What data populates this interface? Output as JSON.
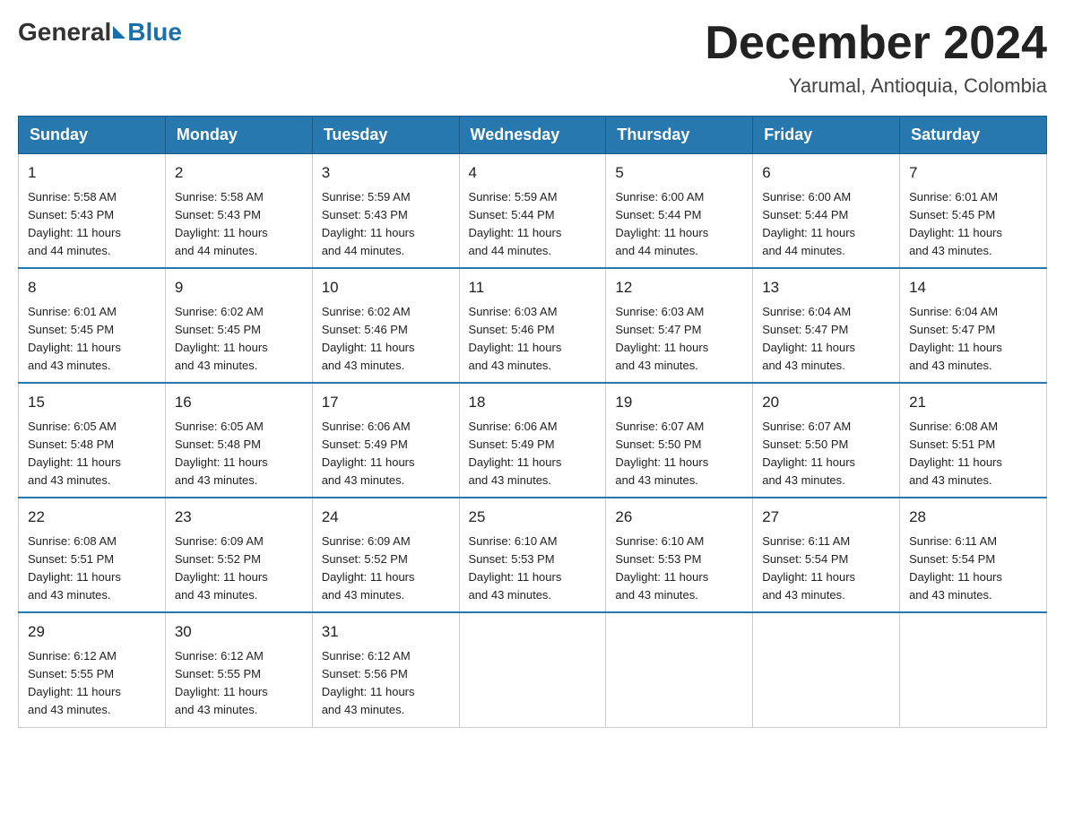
{
  "logo": {
    "general": "General",
    "blue": "Blue"
  },
  "header": {
    "title": "December 2024",
    "subtitle": "Yarumal, Antioquia, Colombia"
  },
  "days_of_week": [
    "Sunday",
    "Monday",
    "Tuesday",
    "Wednesday",
    "Thursday",
    "Friday",
    "Saturday"
  ],
  "weeks": [
    [
      {
        "day": "1",
        "sunrise": "5:58 AM",
        "sunset": "5:43 PM",
        "daylight": "11 hours and 44 minutes."
      },
      {
        "day": "2",
        "sunrise": "5:58 AM",
        "sunset": "5:43 PM",
        "daylight": "11 hours and 44 minutes."
      },
      {
        "day": "3",
        "sunrise": "5:59 AM",
        "sunset": "5:43 PM",
        "daylight": "11 hours and 44 minutes."
      },
      {
        "day": "4",
        "sunrise": "5:59 AM",
        "sunset": "5:44 PM",
        "daylight": "11 hours and 44 minutes."
      },
      {
        "day": "5",
        "sunrise": "6:00 AM",
        "sunset": "5:44 PM",
        "daylight": "11 hours and 44 minutes."
      },
      {
        "day": "6",
        "sunrise": "6:00 AM",
        "sunset": "5:44 PM",
        "daylight": "11 hours and 44 minutes."
      },
      {
        "day": "7",
        "sunrise": "6:01 AM",
        "sunset": "5:45 PM",
        "daylight": "11 hours and 43 minutes."
      }
    ],
    [
      {
        "day": "8",
        "sunrise": "6:01 AM",
        "sunset": "5:45 PM",
        "daylight": "11 hours and 43 minutes."
      },
      {
        "day": "9",
        "sunrise": "6:02 AM",
        "sunset": "5:45 PM",
        "daylight": "11 hours and 43 minutes."
      },
      {
        "day": "10",
        "sunrise": "6:02 AM",
        "sunset": "5:46 PM",
        "daylight": "11 hours and 43 minutes."
      },
      {
        "day": "11",
        "sunrise": "6:03 AM",
        "sunset": "5:46 PM",
        "daylight": "11 hours and 43 minutes."
      },
      {
        "day": "12",
        "sunrise": "6:03 AM",
        "sunset": "5:47 PM",
        "daylight": "11 hours and 43 minutes."
      },
      {
        "day": "13",
        "sunrise": "6:04 AM",
        "sunset": "5:47 PM",
        "daylight": "11 hours and 43 minutes."
      },
      {
        "day": "14",
        "sunrise": "6:04 AM",
        "sunset": "5:47 PM",
        "daylight": "11 hours and 43 minutes."
      }
    ],
    [
      {
        "day": "15",
        "sunrise": "6:05 AM",
        "sunset": "5:48 PM",
        "daylight": "11 hours and 43 minutes."
      },
      {
        "day": "16",
        "sunrise": "6:05 AM",
        "sunset": "5:48 PM",
        "daylight": "11 hours and 43 minutes."
      },
      {
        "day": "17",
        "sunrise": "6:06 AM",
        "sunset": "5:49 PM",
        "daylight": "11 hours and 43 minutes."
      },
      {
        "day": "18",
        "sunrise": "6:06 AM",
        "sunset": "5:49 PM",
        "daylight": "11 hours and 43 minutes."
      },
      {
        "day": "19",
        "sunrise": "6:07 AM",
        "sunset": "5:50 PM",
        "daylight": "11 hours and 43 minutes."
      },
      {
        "day": "20",
        "sunrise": "6:07 AM",
        "sunset": "5:50 PM",
        "daylight": "11 hours and 43 minutes."
      },
      {
        "day": "21",
        "sunrise": "6:08 AM",
        "sunset": "5:51 PM",
        "daylight": "11 hours and 43 minutes."
      }
    ],
    [
      {
        "day": "22",
        "sunrise": "6:08 AM",
        "sunset": "5:51 PM",
        "daylight": "11 hours and 43 minutes."
      },
      {
        "day": "23",
        "sunrise": "6:09 AM",
        "sunset": "5:52 PM",
        "daylight": "11 hours and 43 minutes."
      },
      {
        "day": "24",
        "sunrise": "6:09 AM",
        "sunset": "5:52 PM",
        "daylight": "11 hours and 43 minutes."
      },
      {
        "day": "25",
        "sunrise": "6:10 AM",
        "sunset": "5:53 PM",
        "daylight": "11 hours and 43 minutes."
      },
      {
        "day": "26",
        "sunrise": "6:10 AM",
        "sunset": "5:53 PM",
        "daylight": "11 hours and 43 minutes."
      },
      {
        "day": "27",
        "sunrise": "6:11 AM",
        "sunset": "5:54 PM",
        "daylight": "11 hours and 43 minutes."
      },
      {
        "day": "28",
        "sunrise": "6:11 AM",
        "sunset": "5:54 PM",
        "daylight": "11 hours and 43 minutes."
      }
    ],
    [
      {
        "day": "29",
        "sunrise": "6:12 AM",
        "sunset": "5:55 PM",
        "daylight": "11 hours and 43 minutes."
      },
      {
        "day": "30",
        "sunrise": "6:12 AM",
        "sunset": "5:55 PM",
        "daylight": "11 hours and 43 minutes."
      },
      {
        "day": "31",
        "sunrise": "6:12 AM",
        "sunset": "5:56 PM",
        "daylight": "11 hours and 43 minutes."
      },
      null,
      null,
      null,
      null
    ]
  ],
  "labels": {
    "sunrise_prefix": "Sunrise: ",
    "sunset_prefix": "Sunset: ",
    "daylight_prefix": "Daylight: "
  }
}
